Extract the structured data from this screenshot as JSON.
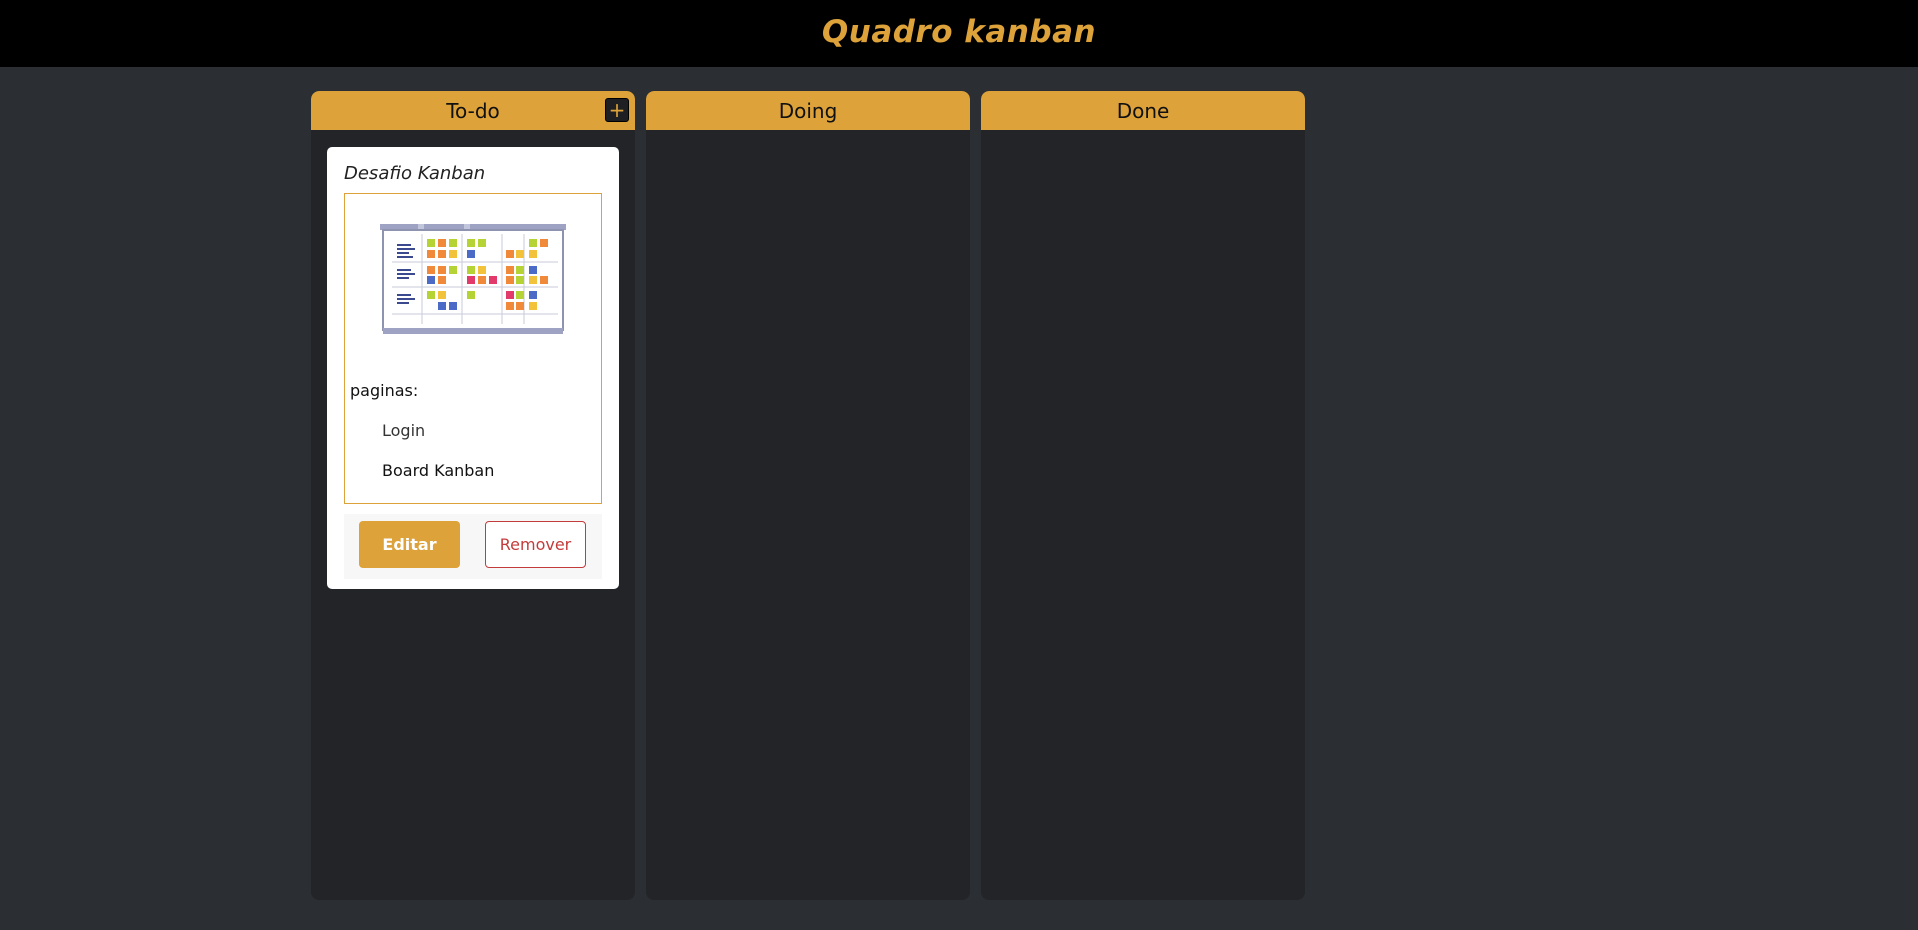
{
  "header": {
    "title": "Quadro kanban"
  },
  "columns": [
    {
      "title": "To-do",
      "add_label": "+"
    },
    {
      "title": "Doing"
    },
    {
      "title": "Done"
    }
  ],
  "card": {
    "title": "Desafio Kanban",
    "image": "kanban-board-illustration",
    "pages_label": "paginas:",
    "pages": [
      "Login",
      "Board Kanban"
    ],
    "edit_label": "Editar",
    "remove_label": "Remover"
  },
  "colors": {
    "accent": "#dda23a",
    "background": "#2b2e33",
    "column": "#222428",
    "topbar": "#000000",
    "danger": "#c43b3b"
  }
}
